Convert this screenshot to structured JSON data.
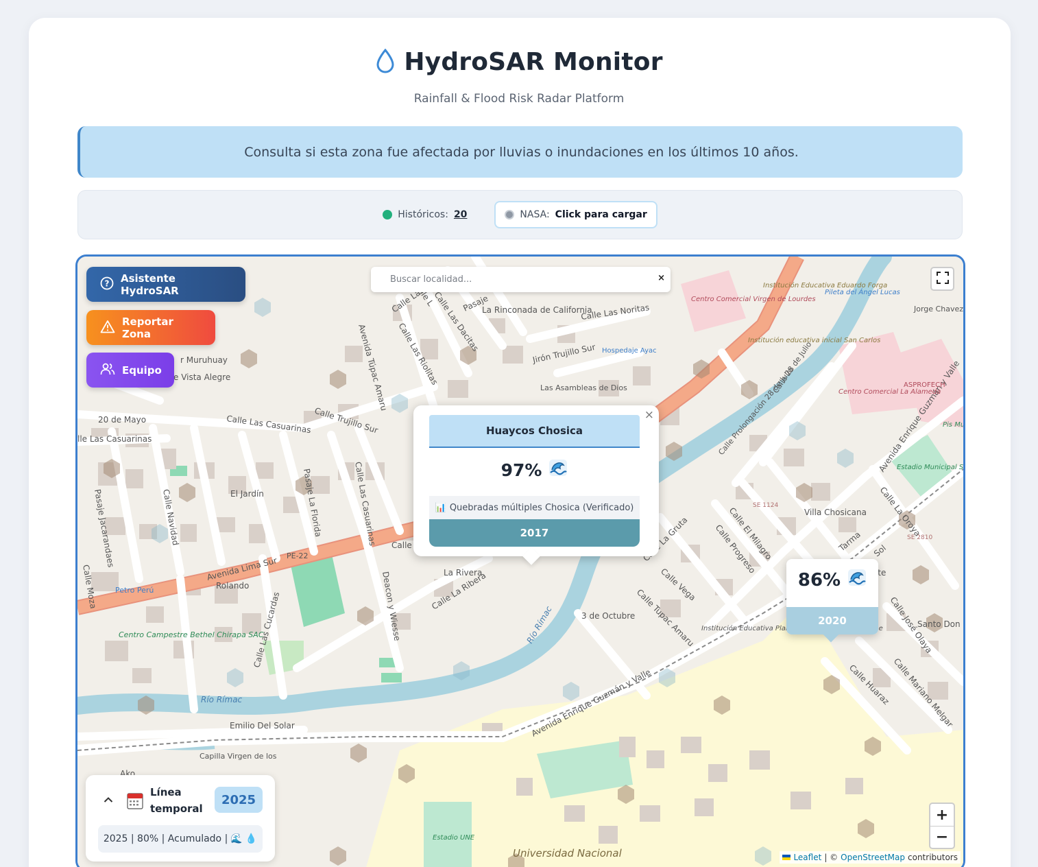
{
  "app": {
    "title": "HydroSAR Monitor",
    "subtitle": "Rainfall & Flood Risk Radar Platform",
    "notice": "Consulta si esta zona fue afectada por lluvias o inundaciones en los últimos 10 años."
  },
  "status": {
    "historicos_label": "Históricos:",
    "historicos_count": "20",
    "nasa_label": "NASA:",
    "nasa_action": "Click para cargar",
    "colors": {
      "historicos": "#22b07d",
      "nasa": "#8f98a4"
    }
  },
  "sidebar": {
    "asistente": "Asistente HydroSAR",
    "reportar": "Reportar Zona",
    "equipo": "Equipo"
  },
  "search": {
    "placeholder": "Buscar localidad...",
    "clear": "×"
  },
  "popup": {
    "title": "Huaycos Chosica",
    "percent": "97%",
    "icon": "wave-icon",
    "source_icon": "📊",
    "source": "Quebradas múltiples Chosica (Verificado)",
    "year": "2017",
    "close": "×"
  },
  "marker": {
    "percent": "86%",
    "icon": "wave-icon",
    "year": "2020"
  },
  "timeline": {
    "label": "Línea temporal",
    "year": "2025",
    "info": "2025 | 80% | Acumulado |",
    "info_icons": [
      "🌊",
      "💧"
    ]
  },
  "zoom": {
    "in": "+",
    "out": "−"
  },
  "attribution": {
    "leaflet": "Leaflet",
    "separator": "| ©",
    "osm": "OpenStreetMap",
    "suffix": "contributors"
  },
  "map_labels": {
    "la_rinconada": "La Rinconada de California",
    "calle_las_noritas": "Calle Las Noritas",
    "centro_comercial_virgen": "Centro Comercial Virgen de Lourdes",
    "institucion_eduardo": "Institución Educativa Eduardo Forga",
    "pileta": "Pileta del Ángel Lucas",
    "jorge_chavez": "Jorge Chavez",
    "institucion_san_carlos": "Institución educativa inicial San Carlos",
    "hospedaje": "Hospedaje Ayac",
    "jiron_trujillo": "Jirón Trujillo Sur",
    "las_asambleas": "Las Asambleas de Dios",
    "calle_28_julio": "Calle 28 de Julio",
    "calle_prolongacion": "Calle Prolongación 28 de Julio",
    "centro_comercial_alameda": "Centro Comercial La Alameda",
    "asprofech": "ASPROFECH",
    "muruhuay": "r Muruhuay",
    "vista_alegre": "e Vista Alegre",
    "veinte_mayo": "20 de Mayo",
    "calle_las_casuarinas": "Calle Las Casuarinas",
    "lle_las_casuarinas": "lle Las Casuarinas",
    "calle_trujillo_sur": "Calle Trujillo Sur",
    "el_jardin": "El Jardín",
    "pasaje_la_florida": "Pasaje La Florida",
    "calle_las_casuarinas_v": "Calle Las Casuarinas",
    "calle_navidad": "Calle Navidad",
    "pasaje_jacarandaes": "Pasaje Jacarandaes",
    "avenida_lima_sur": "Avenida Lima Sur",
    "pe22": "PE-22",
    "rolando": "Rolando",
    "petro_peru": "Petro Perú",
    "centro_campestre": "Centro Campestre Bethel Chirapa SAC",
    "la_rivera": "La Rivera",
    "calle_la_ribera": "Calle La Ribera",
    "deacon": "Deacon y Wiesse",
    "calle_las_cucardas": "Calle Las Cucardas",
    "rio_rimac": "Río Rímac",
    "rio_rimac_2": "Río Rímac",
    "emilio": "Emilio Del Solar",
    "capilla": "Capilla Virgen de los",
    "tres_octubre": "3 de Octubre",
    "calle_tupac_amaru": "Calle Tupac Amaru",
    "calle_vega": "Calle Vega",
    "calle_la_gruta": "Calle La Gruta",
    "calle_progreso": "Calle Progreso",
    "calle_el_milagro": "Calle El Milagro",
    "villa_chosicana": "Villa Chosicana",
    "estadio_solis": "Estadio Municipal Solís García",
    "avenida_guzman": "Avenida Enrique Guzmán y Valle",
    "avenida_guzman_2": "Avenida Enrique Guzmán y Valle",
    "institucion_planteles": "Institución Educativa Planteles De Aplicación De Une",
    "santo_don": "Santo Don",
    "calle_jose_olaya": "Calle José Olaya",
    "calle_mariano": "Calle Mariano Melgar",
    "calle_huaraz": "Calle Huaraz",
    "calle_la_oroya": "Calle La Oroya",
    "se_1124": "SE 1124",
    "se_2810": "SE 2810",
    "estadio_une": "Estadio UNE",
    "universidad": "Universidad Nacional",
    "avenida_tupac": "Avenida Túpac Amaru",
    "calle_las_riolitas": "Calle Las Riolitas",
    "calle_las_dacitas": "Calle Las Dacitas",
    "calle_las_d": "Calle Las D",
    "calle_l": "Calle L",
    "pasaje": "Pasaje",
    "calle_moza": "Calle Moza",
    "calle_popup": "Calle",
    "ako": "Ako",
    "tarma": "Tarma",
    "sol": "Sol",
    "orte": "orte",
    "pis_mun": "Pis Mun de Ch"
  }
}
